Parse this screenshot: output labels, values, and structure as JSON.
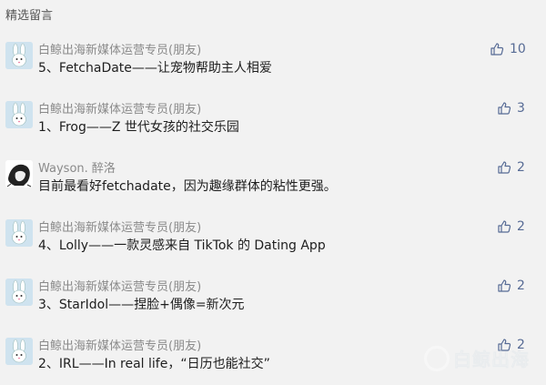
{
  "section": {
    "title": "精选留言"
  },
  "comments": [
    {
      "author": "白鲸出海新媒体运营专员(朋友)",
      "content": "5、FetchaDate——让宠物帮助主人相爱",
      "likes": "10",
      "avatar": "bunny-avatar"
    },
    {
      "author": "白鲸出海新媒体运营专员(朋友)",
      "content": "1、Frog——Z 世代女孩的社交乐园",
      "likes": "3",
      "avatar": "bunny-avatar"
    },
    {
      "author": "Wayson. 醉洛",
      "content": "目前最看好fetchadate，因为趣缘群体的粘性更强。",
      "likes": "2",
      "avatar": "sketch-avatar"
    },
    {
      "author": "白鲸出海新媒体运营专员(朋友)",
      "content": "4、Lolly——一款灵感来自 TikTok 的 Dating App",
      "likes": "2",
      "avatar": "bunny-avatar"
    },
    {
      "author": "白鲸出海新媒体运营专员(朋友)",
      "content": "3、StarIdol——捏脸+偶像=新次元",
      "likes": "2",
      "avatar": "bunny-avatar"
    },
    {
      "author": "白鲸出海新媒体运营专员(朋友)",
      "content": "2、IRL——In real life，“日历也能社交”",
      "likes": "2",
      "avatar": "bunny-avatar"
    }
  ],
  "watermark": {
    "text": "白鲸出海"
  },
  "colors": {
    "like_blue": "#576b95",
    "author_gray": "#8a8a8a",
    "background": "#f2f2f2"
  }
}
